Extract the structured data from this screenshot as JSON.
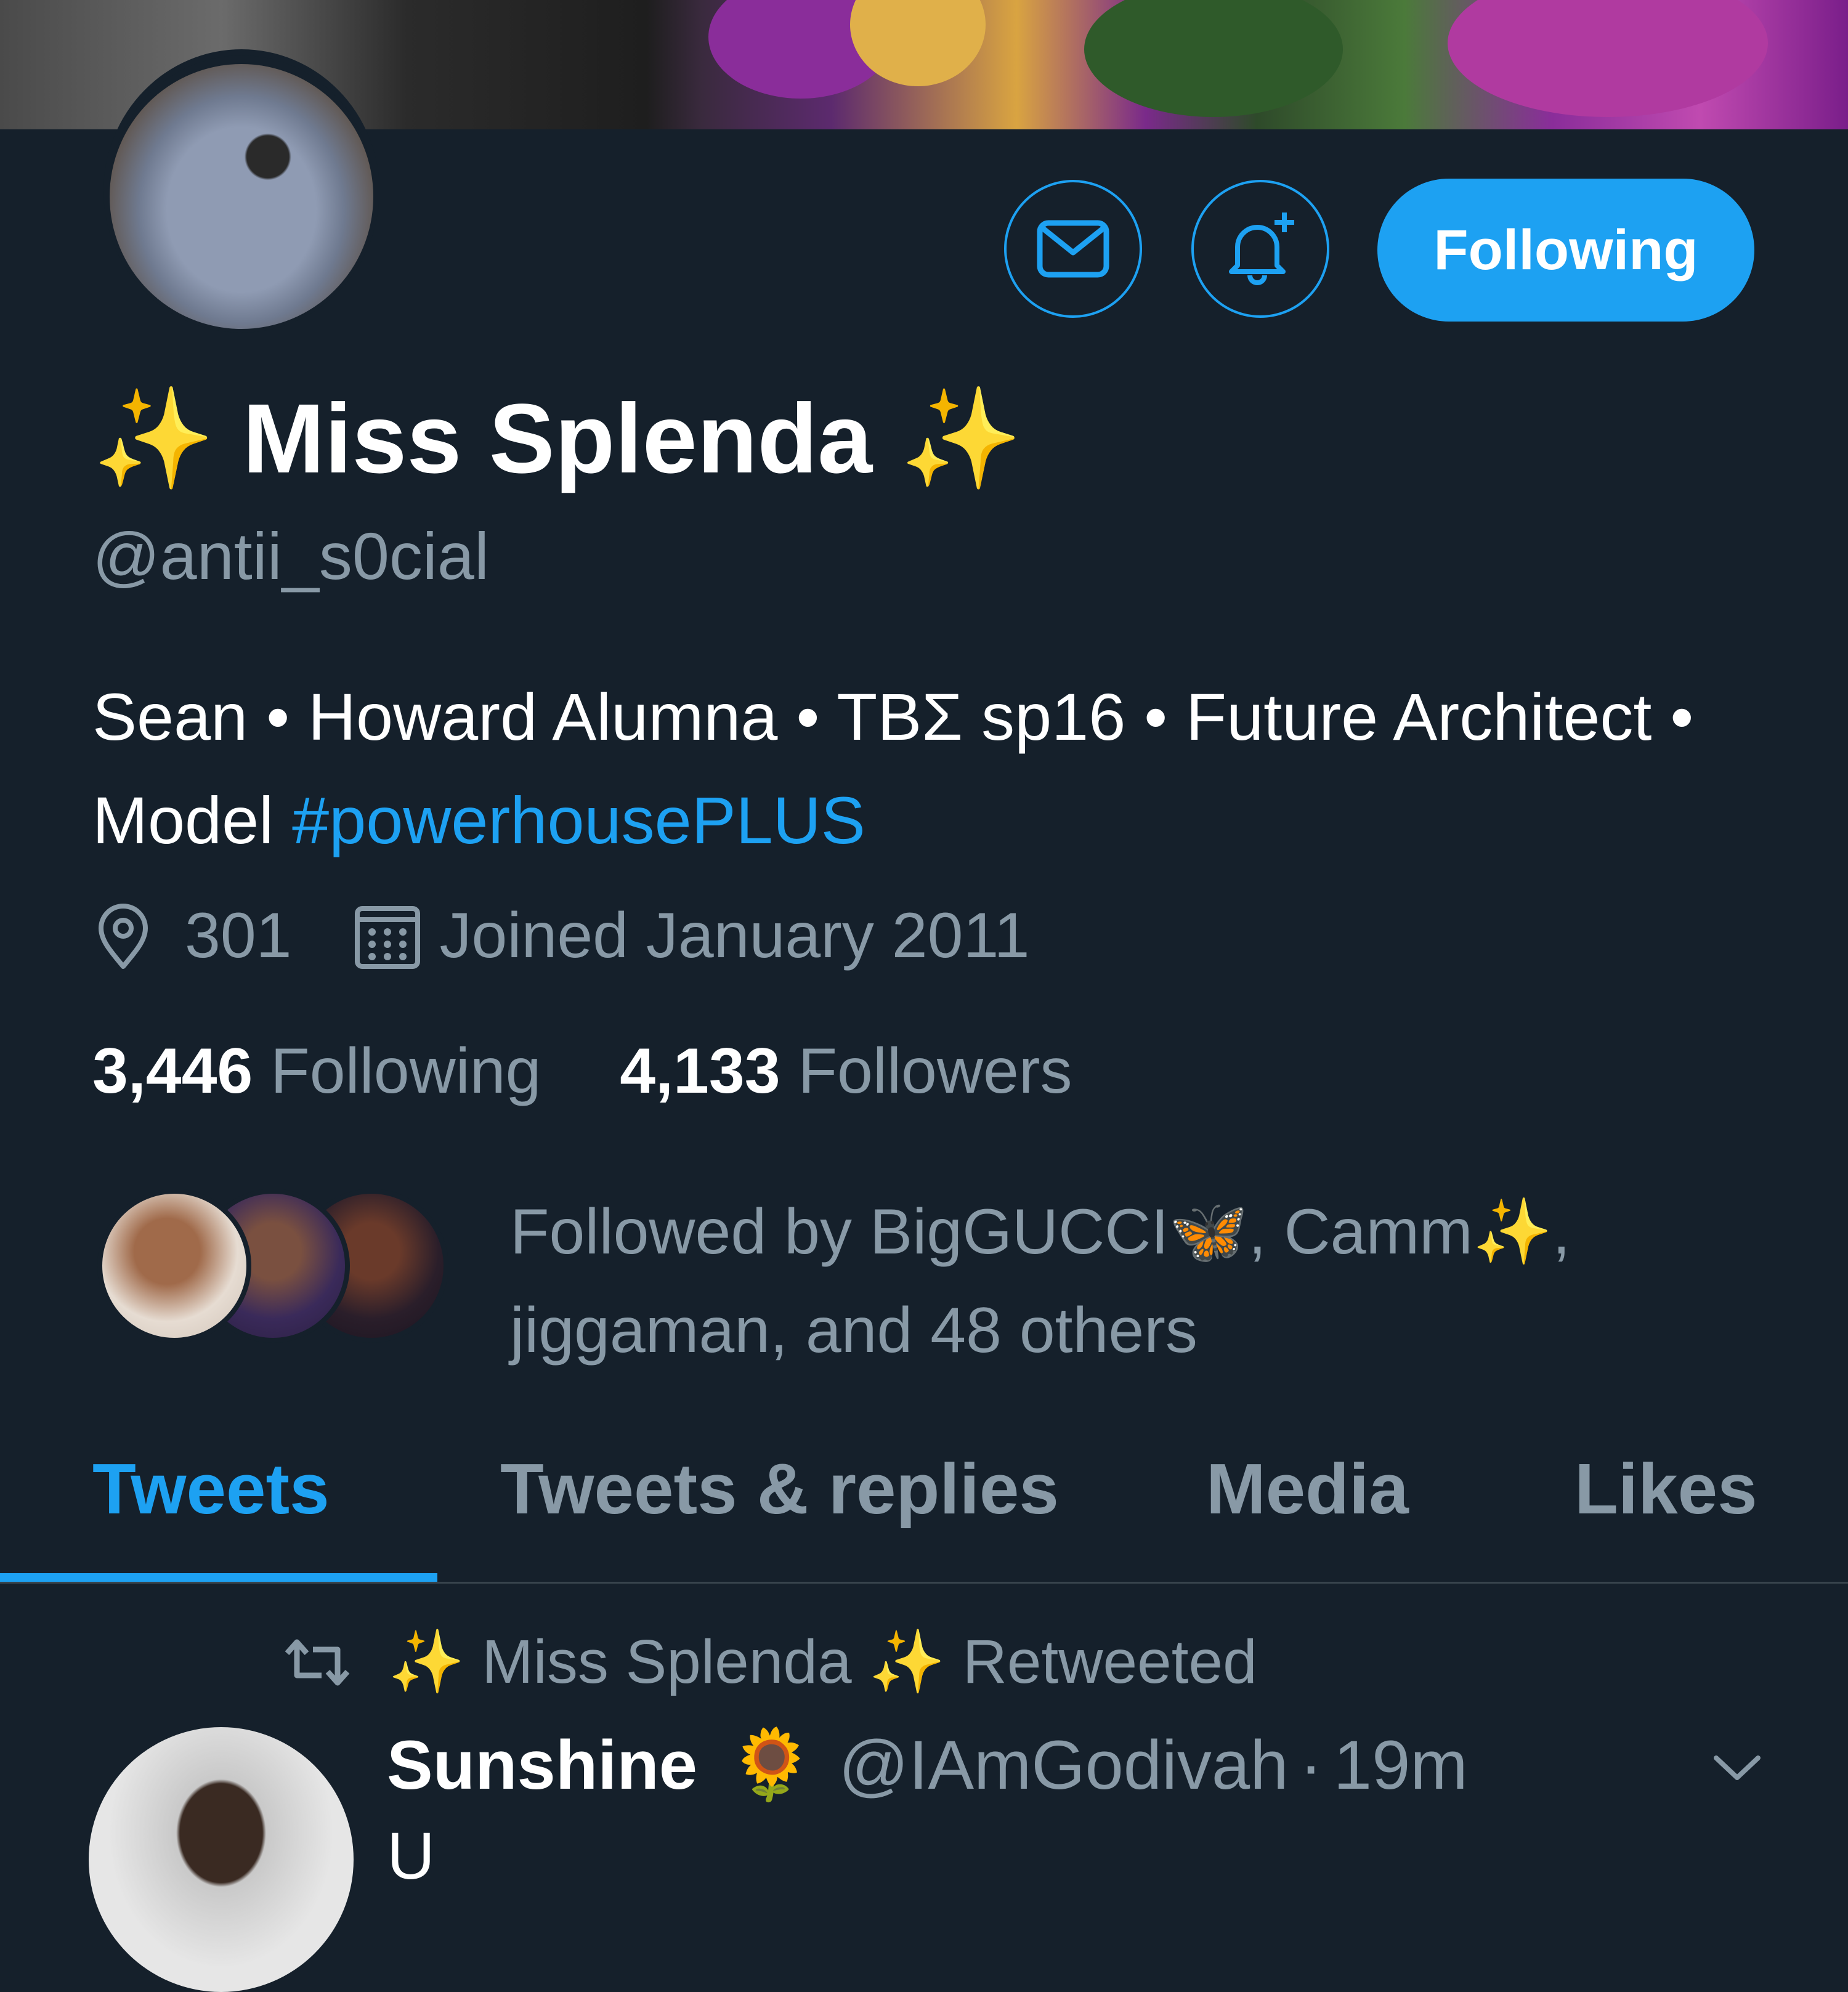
{
  "profile": {
    "display_name": "Miss Splenda",
    "name_emoji_left": "✨",
    "name_emoji_right": "✨",
    "handle": "@antii_s0cial",
    "bio_text": "Sean • Howard Alumna • TBΣ sp16 • Future Architect • Model ",
    "bio_hashtag": "#powerhousePLUS",
    "location": "301",
    "joined": "Joined January 2011",
    "following_count": "3,446",
    "following_label": "Following",
    "followers_count": "4,133",
    "followers_label": "Followers",
    "followed_by": "Followed by BigGUCCI🦋, Camm✨, jiggaman, and 48 others"
  },
  "actions": {
    "message_icon": "mail-icon",
    "notify_icon": "bell-plus-icon",
    "follow_label": "Following"
  },
  "tabs": [
    {
      "label": "Tweets",
      "active": true
    },
    {
      "label": "Tweets & replies",
      "active": false
    },
    {
      "label": "Media",
      "active": false
    },
    {
      "label": "Likes",
      "active": false
    }
  ],
  "tweet": {
    "retweet_context": "✨ Miss Splenda ✨ Retweeted",
    "author_name": "Sunshine",
    "author_emoji": "🌻",
    "author_handle": "@IAmGodivah",
    "separator": "·",
    "time": "19m",
    "body_preview": "U"
  },
  "colors": {
    "background": "#15202b",
    "accent": "#1da1f2",
    "secondary_text": "#8899a6",
    "divider": "#38444d"
  }
}
